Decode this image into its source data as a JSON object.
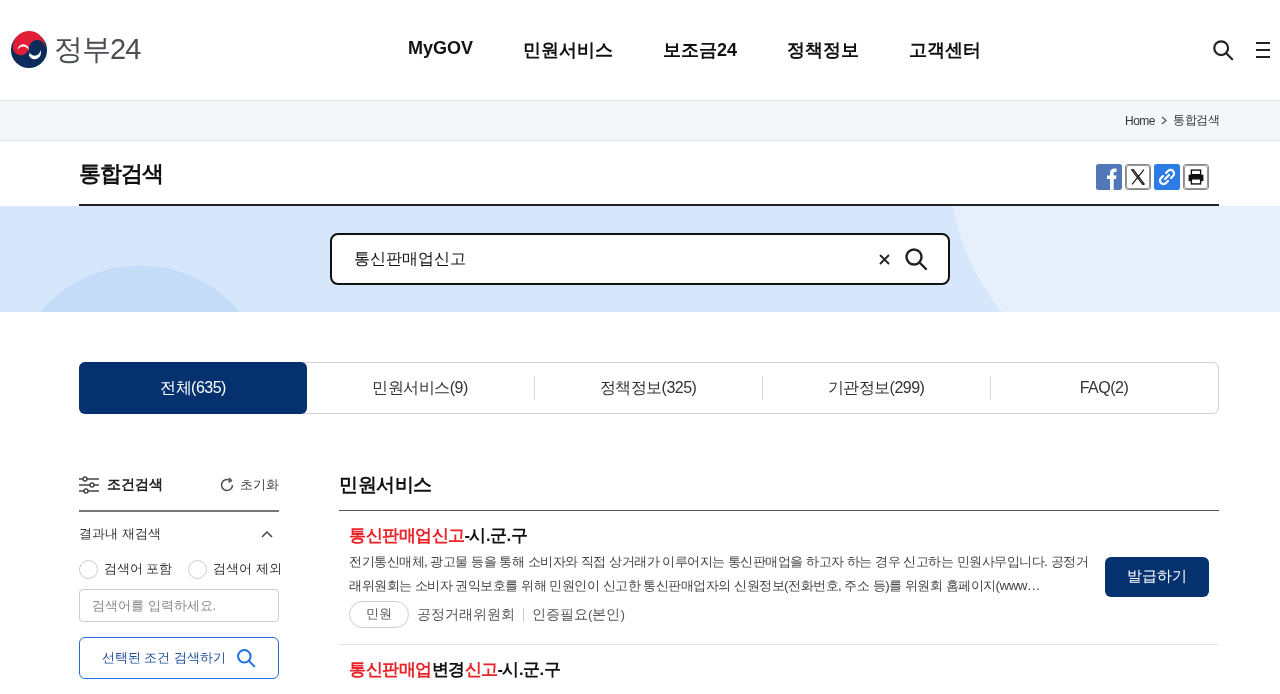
{
  "header": {
    "logo_text": "정부24",
    "nav": [
      "MyGOV",
      "민원서비스",
      "보조금24",
      "정책정보",
      "고객센터"
    ]
  },
  "breadcrumb": [
    "Home",
    "통합검색"
  ],
  "page_title": "통합검색",
  "search": {
    "value": "통신판매업신고"
  },
  "tabs": [
    {
      "label": "전체(635)",
      "selected": true
    },
    {
      "label": "민원서비스(9)",
      "selected": false
    },
    {
      "label": "정책정보(325)",
      "selected": false
    },
    {
      "label": "기관정보(299)",
      "selected": false
    },
    {
      "label": "FAQ(2)",
      "selected": false
    }
  ],
  "filter": {
    "title": "조건검색",
    "reset": "초기화",
    "section": {
      "title": "결과내 재검색",
      "expanded": true
    },
    "options": [
      {
        "label": "검색어 포함",
        "selected": false
      },
      {
        "label": "검색어 제외",
        "selected": false
      }
    ],
    "input_placeholder": "검색어를 입력하세요.",
    "submit": "선택된 조건 검색하기"
  },
  "results": {
    "heading": "민원서비스",
    "items": [
      {
        "title": [
          {
            "text": "통신판매업신고",
            "highlight": true
          },
          {
            "text": "-시.군.구",
            "highlight": false
          }
        ],
        "description": "전기통신매체, 광고물 등을 통해 소비자와 직접 상거래가 이루어지는 통신판매업을 하고자 하는 경우 신고하는 민원사무입니다. 공정거래위원회는 소비자 권익보호를 위해 민원인이 신고한 통신판매업자의 신원정보(전화번호, 주소 등)를 위원회 홈페이지(www…",
        "tag": "민원",
        "agency": "공정거래위원회",
        "auth": "인증필요(본인)",
        "action": "발급하기"
      },
      {
        "title": [
          {
            "text": "통신판매업",
            "highlight": true
          },
          {
            "text": "변경",
            "highlight": false
          },
          {
            "text": "신고",
            "highlight": true
          },
          {
            "text": "-시.군.구",
            "highlight": false
          }
        ]
      }
    ]
  }
}
